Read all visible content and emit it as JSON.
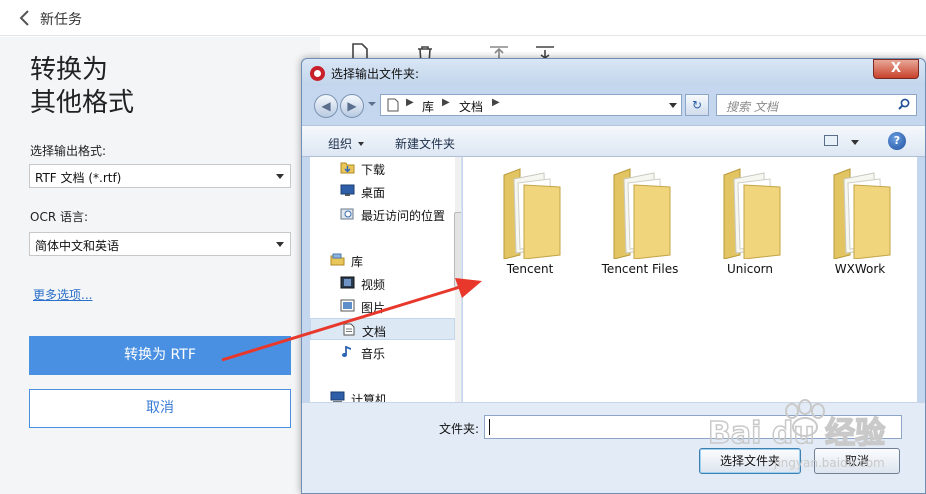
{
  "app": {
    "header_title": "新任务",
    "headline_line1": "转换为",
    "headline_line2": "其他格式",
    "output_format_label": "选择输出格式:",
    "output_format_value": "RTF 文档 (*.rtf)",
    "ocr_label": "OCR 语言:",
    "ocr_value": "简体中文和英语",
    "more_options": "更多选项...",
    "convert_button": "转换为 RTF",
    "cancel_button": "取消",
    "accent_color": "#4a90e2"
  },
  "dialog": {
    "title": "选择输出文件夹:",
    "close_label": "X",
    "breadcrumb": [
      "库",
      "文档"
    ],
    "search_placeholder": "搜索 文档",
    "commands": {
      "organize": "组织",
      "new_folder": "新建文件夹"
    },
    "help_label": "?",
    "nav_items": [
      {
        "label": "下载",
        "icon": "download-folder-icon"
      },
      {
        "label": "桌面",
        "icon": "desktop-icon"
      },
      {
        "label": "最近访问的位置",
        "icon": "recent-places-icon"
      },
      {
        "label": "库",
        "icon": "library-icon"
      },
      {
        "label": "视频",
        "icon": "video-icon"
      },
      {
        "label": "图片",
        "icon": "pictures-icon"
      },
      {
        "label": "文档",
        "icon": "documents-icon",
        "selected": true
      },
      {
        "label": "音乐",
        "icon": "music-icon"
      },
      {
        "label": "计算机",
        "icon": "computer-icon"
      }
    ],
    "folders": [
      "Tencent",
      "Tencent Files",
      "Unicorn",
      "WXWork"
    ],
    "folder_field_label": "文件夹:",
    "folder_field_value": "",
    "select_button": "选择文件夹",
    "cancel_button": "取消"
  },
  "watermark": {
    "text": "Bai du 经验",
    "url": "jingyan.baidu.com"
  }
}
